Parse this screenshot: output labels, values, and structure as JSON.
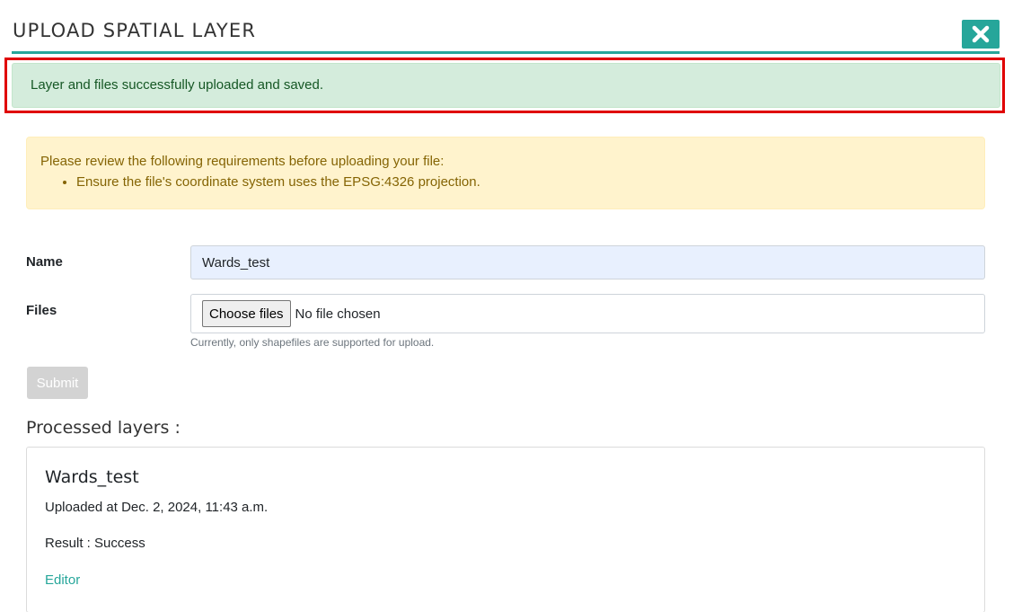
{
  "header": {
    "title": "UPLOAD SPATIAL LAYER",
    "accent_color": "#26a69a",
    "close_icon": "close-icon"
  },
  "success_alert": {
    "message": "Layer and files successfully uploaded and saved."
  },
  "requirements_alert": {
    "intro": "Please review the following requirements before uploading your file:",
    "items": [
      "Ensure the file's coordinate system uses the EPSG:4326 projection."
    ]
  },
  "form": {
    "name_label": "Name",
    "name_value": "Wards_test",
    "files_label": "Files",
    "choose_files_label": "Choose files",
    "no_file_text": "No file chosen",
    "files_help": "Currently, only shapefiles are supported for upload.",
    "submit_label": "Submit"
  },
  "processed": {
    "heading": "Processed layers :",
    "layers": [
      {
        "name": "Wards_test",
        "uploaded": "Uploaded at Dec. 2, 2024, 11:43 a.m.",
        "result": "Result : Success",
        "editor_link": "Editor"
      }
    ]
  }
}
